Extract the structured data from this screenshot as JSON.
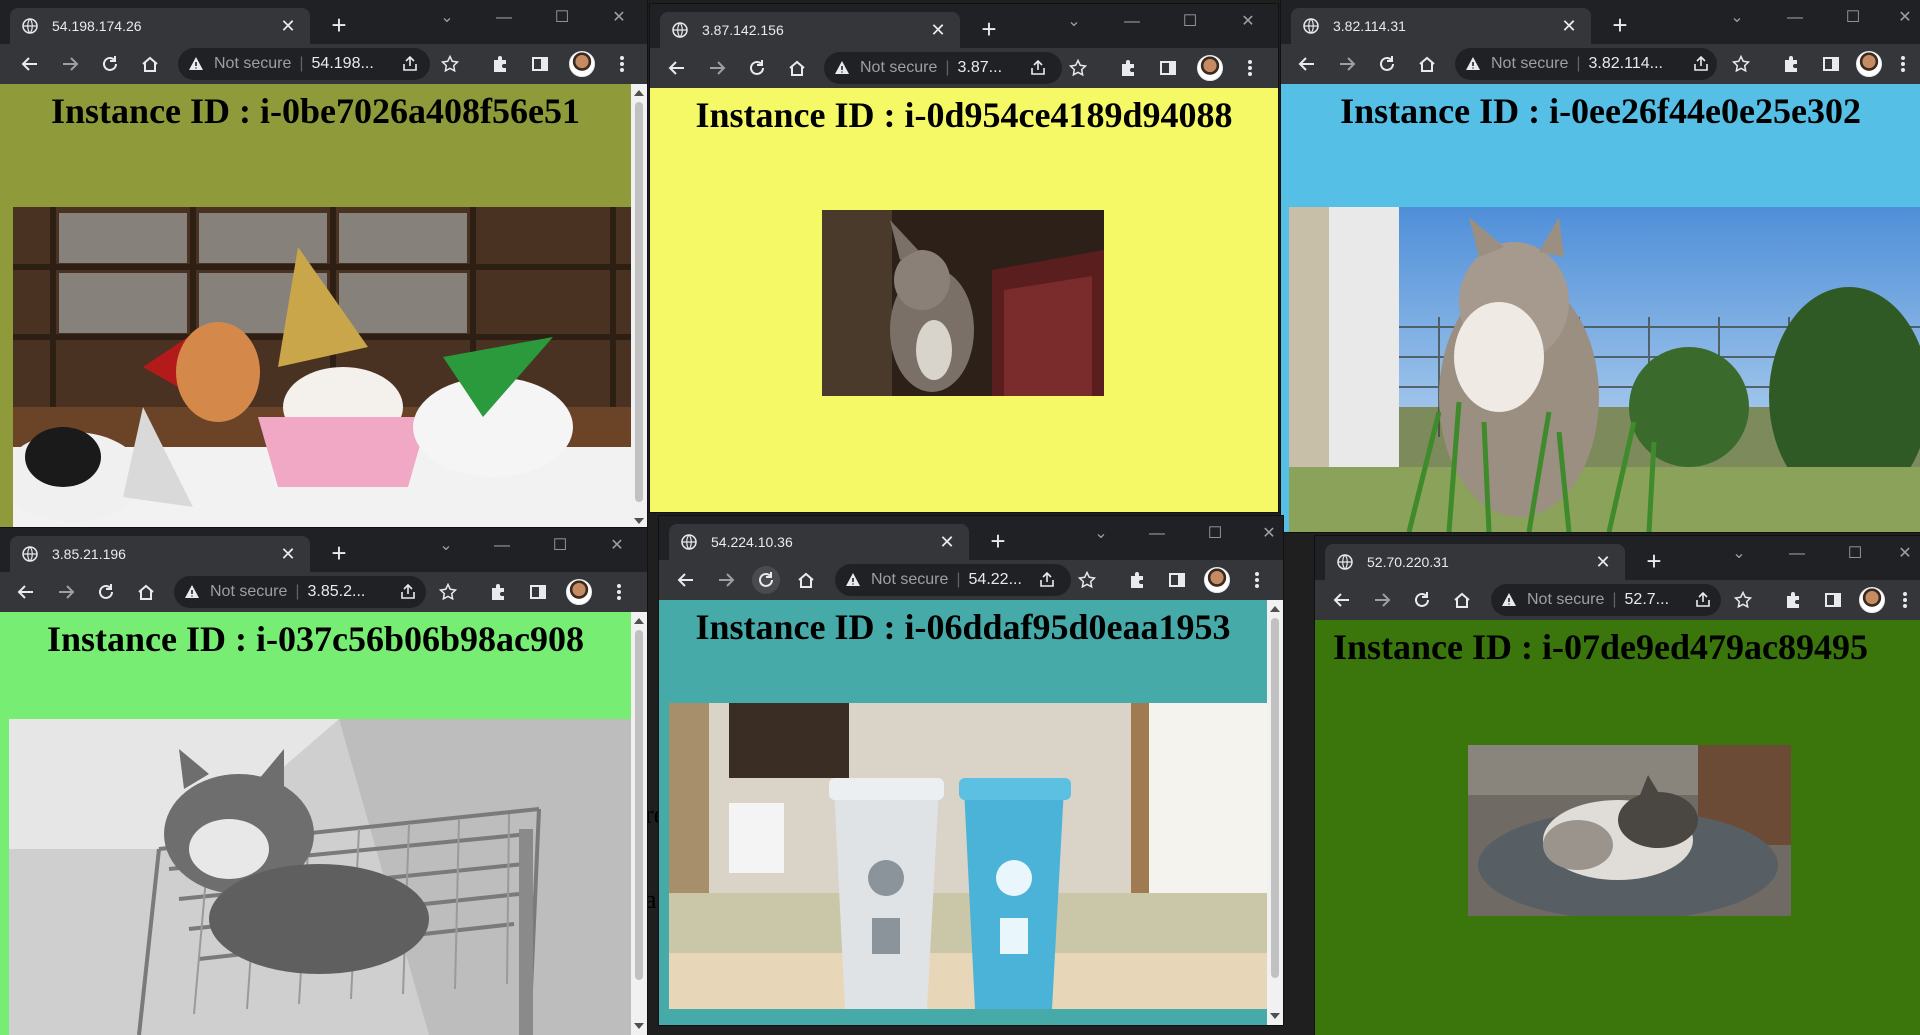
{
  "browser": {
    "not_secure_label": "Not secure",
    "separator": "|",
    "new_tab_symbol": "+",
    "close_tab_symbol": "✕",
    "window_controls": {
      "tabs_menu": "⌄",
      "minimize": "—",
      "maximize": "☐",
      "close": "✕"
    }
  },
  "windows": [
    {
      "tab_title": "54.198.174.26",
      "url": "54.198...",
      "heading": "Instance ID : i-0be7026a408f56e51",
      "background": "#8f9b3a",
      "photo": "cats wearing party hats around a pink bowl"
    },
    {
      "tab_title": "3.87.142.156",
      "url": "3.87...",
      "heading": "Instance ID : i-0d954ce4189d94088",
      "background": "#f5f965",
      "photo": "cat standing up reaching a door handle"
    },
    {
      "tab_title": "3.82.114.31",
      "url": "3.82.114...",
      "heading": "Instance ID : i-0ee26f44e0e25e302",
      "background": "#55bfe6",
      "photo": "cat sitting in grass looking at the sky"
    },
    {
      "tab_title": "3.85.21.196",
      "url": "3.85.2...",
      "heading": "Instance ID : i-037c56b06b98ac908",
      "background": "#77ed73",
      "photo": "cat lying on a wire shelf rack"
    },
    {
      "tab_title": "54.224.10.36",
      "url": "54.22...",
      "heading": "Instance ID : i-06ddaf95d0eaa1953",
      "background": "#46aaa9",
      "photo": "white and blue recycling bins in a room"
    },
    {
      "tab_title": "52.70.220.31",
      "url": "52.7...",
      "heading": "Instance ID : i-07de9ed479ac89495",
      "background": "#3a760b",
      "photo": "cat sleeping on a cushion"
    }
  ],
  "background_fragments": [
    "re",
    "a"
  ],
  "icons": {
    "site": "globe-icon",
    "back": "back-arrow-icon",
    "forward": "forward-arrow-icon",
    "reload": "reload-icon",
    "home": "home-icon",
    "warning": "warning-icon",
    "share": "share-icon",
    "bookmark": "star-icon",
    "extensions": "puzzle-icon",
    "side_panel": "side-panel-icon",
    "menu": "kebab-menu-icon",
    "profile": "avatar"
  },
  "colors": {
    "chrome_frame": "#202124",
    "toolbar": "#35363a",
    "text": "#e8eaed",
    "icon_muted": "#9aa0a6"
  }
}
